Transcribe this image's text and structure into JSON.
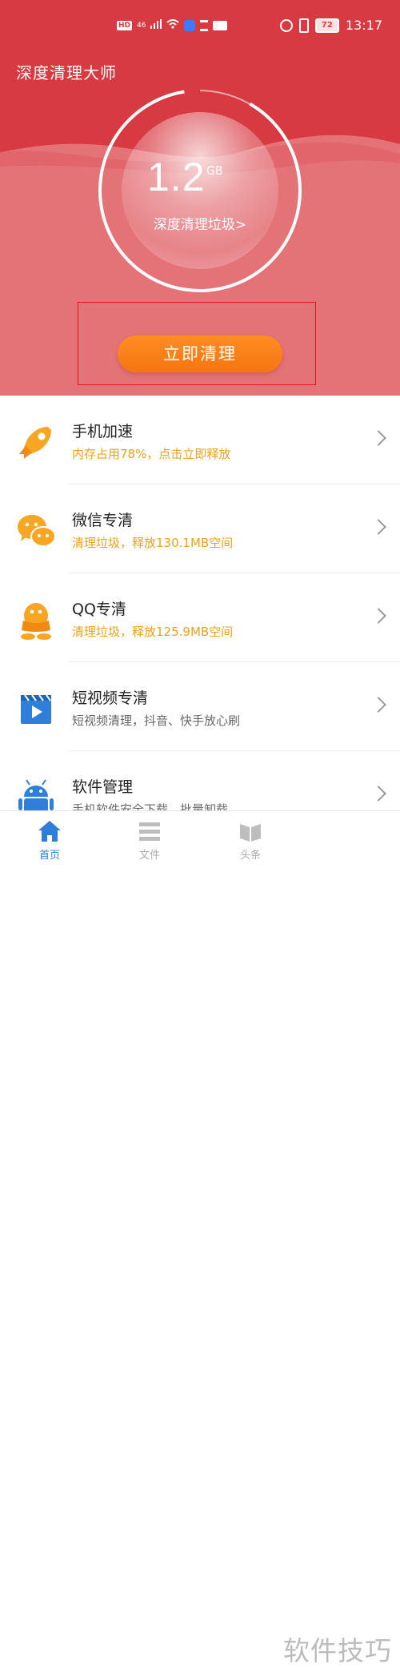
{
  "status_bar": {
    "hd": "HD",
    "network": "46",
    "battery": "72",
    "time": "13:17",
    "color": "#d73a41"
  },
  "hero": {
    "app_title": "深度清理大师",
    "size_value": "1.2",
    "size_unit": "GB",
    "deep_clean_link": "深度清理垃圾>",
    "clean_button": "立即清理",
    "colors": {
      "top": "#d73a41",
      "body": "#e47378",
      "button": "#f57512"
    }
  },
  "features": [
    {
      "icon": "rocket-icon",
      "title": "手机加速",
      "subtitle": "内存占用78%，点击立即释放",
      "subtitle_color": "orange"
    },
    {
      "icon": "wechat-icon",
      "title": "微信专清",
      "subtitle": "清理垃圾，释放130.1MB空间",
      "subtitle_color": "orange"
    },
    {
      "icon": "qq-icon",
      "title": "QQ专清",
      "subtitle": "清理垃圾，释放125.9MB空间",
      "subtitle_color": "orange"
    },
    {
      "icon": "video-icon",
      "title": "短视频专清",
      "subtitle": "短视频清理，抖音、快手放心刷",
      "subtitle_color": "gray"
    },
    {
      "icon": "android-icon",
      "title": "软件管理",
      "subtitle": "手机软件安全下载，批量卸载",
      "subtitle_color": "gray"
    }
  ],
  "bottom_nav": [
    {
      "label": "首页",
      "icon": "home-icon",
      "active": true
    },
    {
      "label": "文件",
      "icon": "file-list-icon",
      "active": false
    },
    {
      "label": "头条",
      "icon": "book-icon",
      "active": false
    }
  ],
  "watermark": "软件技巧"
}
